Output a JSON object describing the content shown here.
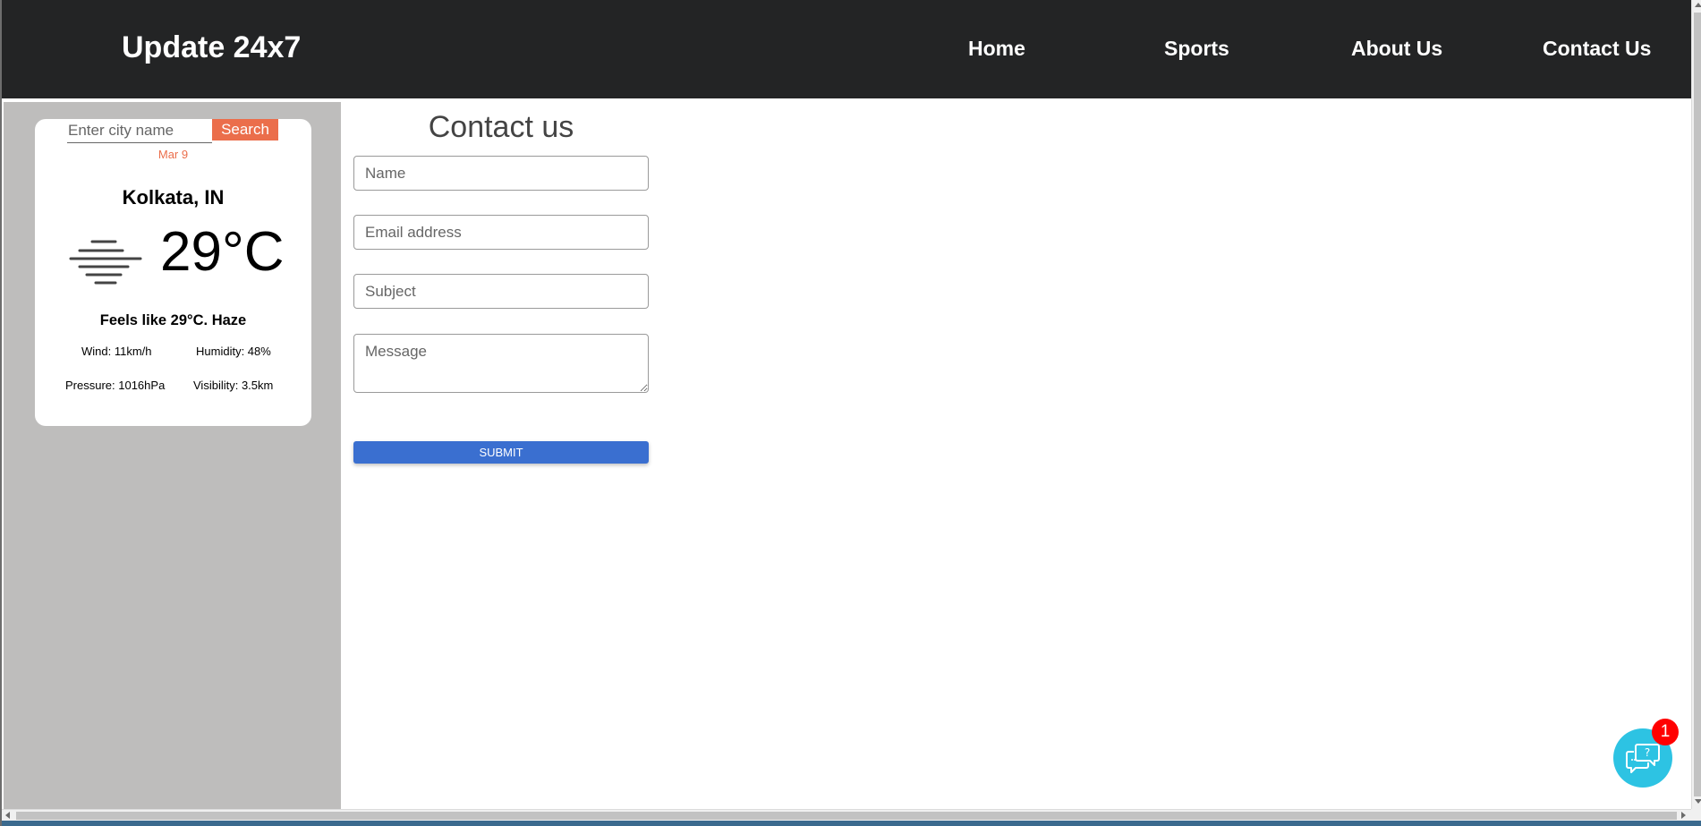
{
  "header": {
    "brand": "Update 24x7",
    "nav": [
      {
        "label": "Home"
      },
      {
        "label": "Sports"
      },
      {
        "label": "About Us"
      },
      {
        "label": "Contact Us"
      }
    ]
  },
  "weather": {
    "search_placeholder": "Enter city name",
    "search_value": "",
    "search_label": "Search",
    "date": "Mar 9",
    "city": "Kolkata, IN",
    "icon": "haze-icon",
    "temperature": "29°C",
    "feels_like": "Feels like 29°C. Haze",
    "wind": "Wind: 11km/h",
    "humidity": "Humidity: 48%",
    "pressure": "Pressure: 1016hPa",
    "visibility": "Visibility: 3.5km",
    "accent_color": "#eb6e4b"
  },
  "contact": {
    "title": "Contact us",
    "name_placeholder": "Name",
    "email_placeholder": "Email address",
    "subject_placeholder": "Subject",
    "message_placeholder": "Message",
    "submit_label": "SUBMIT",
    "submit_color": "#3a6fd0"
  },
  "chat": {
    "icon": "chat-help-icon",
    "badge_count": "1",
    "color": "#2dc3e3"
  }
}
